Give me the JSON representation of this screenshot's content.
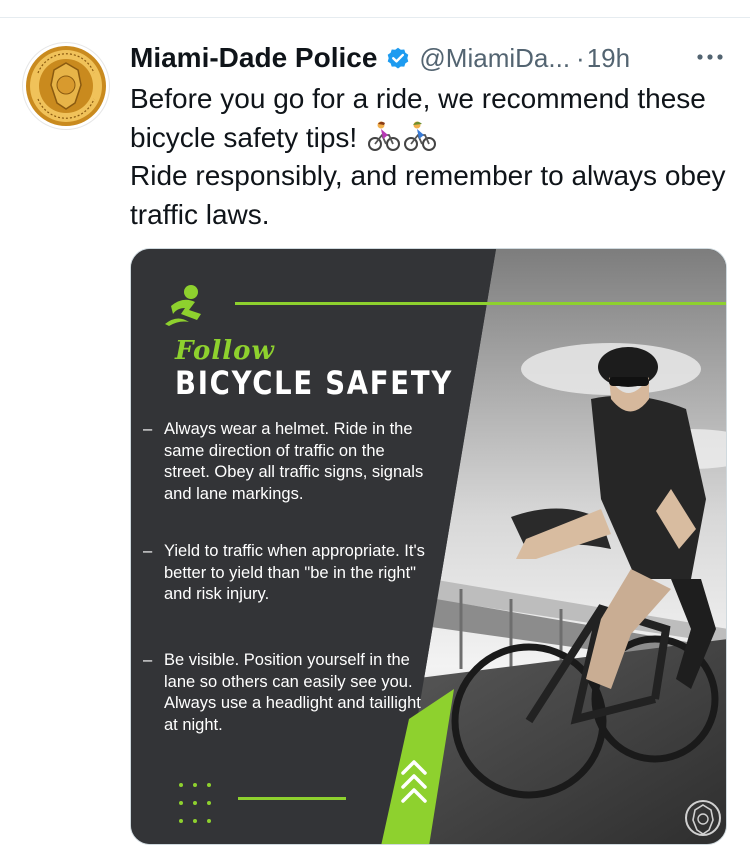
{
  "account": {
    "name": "Miami-Dade Police",
    "handle": "@MiamiDa...",
    "separator": "·",
    "time": "19h",
    "avatar_icon": "police-badge-logo",
    "verified_icon": "verified-badge-icon",
    "more_icon": "more-options-icon"
  },
  "tweet": {
    "line1": "Before you go for a ride, we recommend these bicycle safety tips!",
    "line2": "Ride responsibly, and remember to always obey traffic laws.",
    "emoji_icons": [
      "woman-biking-emoji",
      "man-biking-emoji"
    ]
  },
  "graphic": {
    "follow": "Follow",
    "title": "BICYCLE SAFETY",
    "dash": "–",
    "tips": [
      "Always wear a helmet. Ride in the same direction of traffic on the street. Obey all traffic signs, signals and lane markings.",
      "Yield to traffic when appropriate. It's better to yield than \"be in the right\" and risk injury.",
      "Be visible. Position yourself in the lane so others can easily see you. Always use a headlight and taillight at night."
    ],
    "accent_color": "#8ed12e",
    "panel_color": "#333437",
    "icons": [
      "cyclist-logo-icon",
      "dots-pattern",
      "chevrons-up-icon",
      "police-seal-watermark"
    ]
  },
  "colors": {
    "verified_blue": "#1d9bf0",
    "text_primary": "#0f1419",
    "text_secondary": "#536471"
  }
}
